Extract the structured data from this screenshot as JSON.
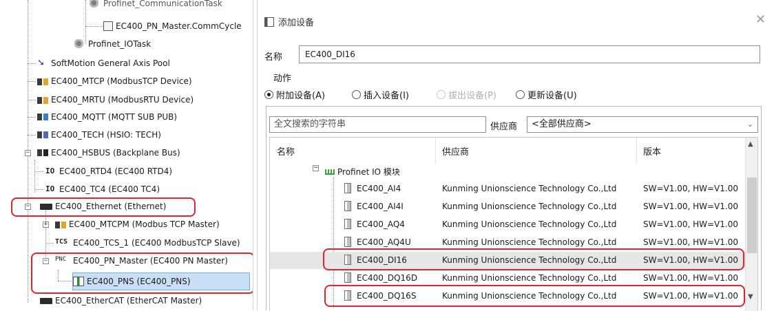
{
  "tree": {
    "items": [
      {
        "label": "Profinet_CommunicationTask",
        "icon": "task-icon"
      },
      {
        "label": "EC400_PN_Master.CommCycle",
        "icon": "cycle-icon"
      },
      {
        "label": "Profinet_IOTask",
        "icon": "task-icon"
      },
      {
        "label": "SoftMotion General Axis Pool",
        "icon": "softmotion-icon"
      },
      {
        "label": "EC400_MTCP (ModbusTCP Device)",
        "icon": "device-icon"
      },
      {
        "label": "EC400_MRTU (ModbusRTU Device)",
        "icon": "device-icon"
      },
      {
        "label": "EC400_MQTT (MQTT SUB PUB)",
        "icon": "device-icon"
      },
      {
        "label": "EC400_TECH (HSIO: TECH)",
        "icon": "device-icon"
      },
      {
        "label": "EC400_HSBUS (Backplane Bus)",
        "icon": "device-icon"
      },
      {
        "label": "EC400_RTD4 (EC400 RTD4)",
        "icon": "io-icon",
        "prefix": "IO"
      },
      {
        "label": "EC400_TC4 (EC400 TC4)",
        "icon": "io-icon",
        "prefix": "IO"
      },
      {
        "label": "EC400_Ethernet (Ethernet)",
        "icon": "ethernet-icon"
      },
      {
        "label": "EC400_MTCPM (Modbus TCP Master)",
        "icon": "device-icon"
      },
      {
        "label": "EC400_TCS_1 (EC400 ModbusTCP Slave)",
        "icon": "tcs-icon",
        "prefix": "TCS"
      },
      {
        "label": "EC400_PN_Master (EC400 PN Master)",
        "icon": "pnc-icon",
        "prefix": "PNC"
      },
      {
        "label": "EC400_PNS (EC400_PNS)",
        "icon": "pns-icon"
      },
      {
        "label": "EC400_EtherCAT (EtherCAT Master)",
        "icon": "ethernet-icon"
      }
    ]
  },
  "dialog": {
    "title": "添加设备",
    "name_label": "名称",
    "name_value": "EC400_DI16",
    "action_label": "动作",
    "actions": [
      {
        "label": "附加设备(A)",
        "selected": true,
        "enabled": true
      },
      {
        "label": "插入设备(I)",
        "selected": false,
        "enabled": true
      },
      {
        "label": "拔出设备(P)",
        "selected": false,
        "enabled": false
      },
      {
        "label": "更新设备(U)",
        "selected": false,
        "enabled": true
      }
    ],
    "search_placeholder": "全文搜索的字符串",
    "vendor_label": "供应商",
    "vendor_value": "<全部供应商>",
    "columns": {
      "name": "名称",
      "vendor": "供应商",
      "version": "版本"
    },
    "category": "Profinet IO 模块",
    "rows": [
      {
        "name": "EC400_AI4",
        "vendor": "Kunming Unionscience Technology Co.,Ltd",
        "version": "SW=V1.00, HW=V1.00"
      },
      {
        "name": "EC400_AI4I",
        "vendor": "Kunming Unionscience Technology Co.,Ltd",
        "version": "SW=V1.00, HW=V1.00"
      },
      {
        "name": "EC400_AQ4",
        "vendor": "Kunming Unionscience Technology Co.,Ltd",
        "version": "SW=V1.00, HW=V1.00"
      },
      {
        "name": "EC400_AQ4U",
        "vendor": "Kunming Unionscience Technology Co.,Ltd",
        "version": "SW=V1.00, HW=V1.00"
      },
      {
        "name": "EC400_DI16",
        "vendor": "Kunming Unionscience Technology Co.,Ltd",
        "version": "SW=V1.00, HW=V1.00",
        "selected": true
      },
      {
        "name": "EC400_DQ16D",
        "vendor": "Kunming Unionscience Technology Co.,Ltd",
        "version": "SW=V1.00, HW=V1.00"
      },
      {
        "name": "EC400_DQ16S",
        "vendor": "Kunming Unionscience Technology Co.,Ltd",
        "version": "SW=V1.00, HW=V1.00"
      }
    ]
  }
}
